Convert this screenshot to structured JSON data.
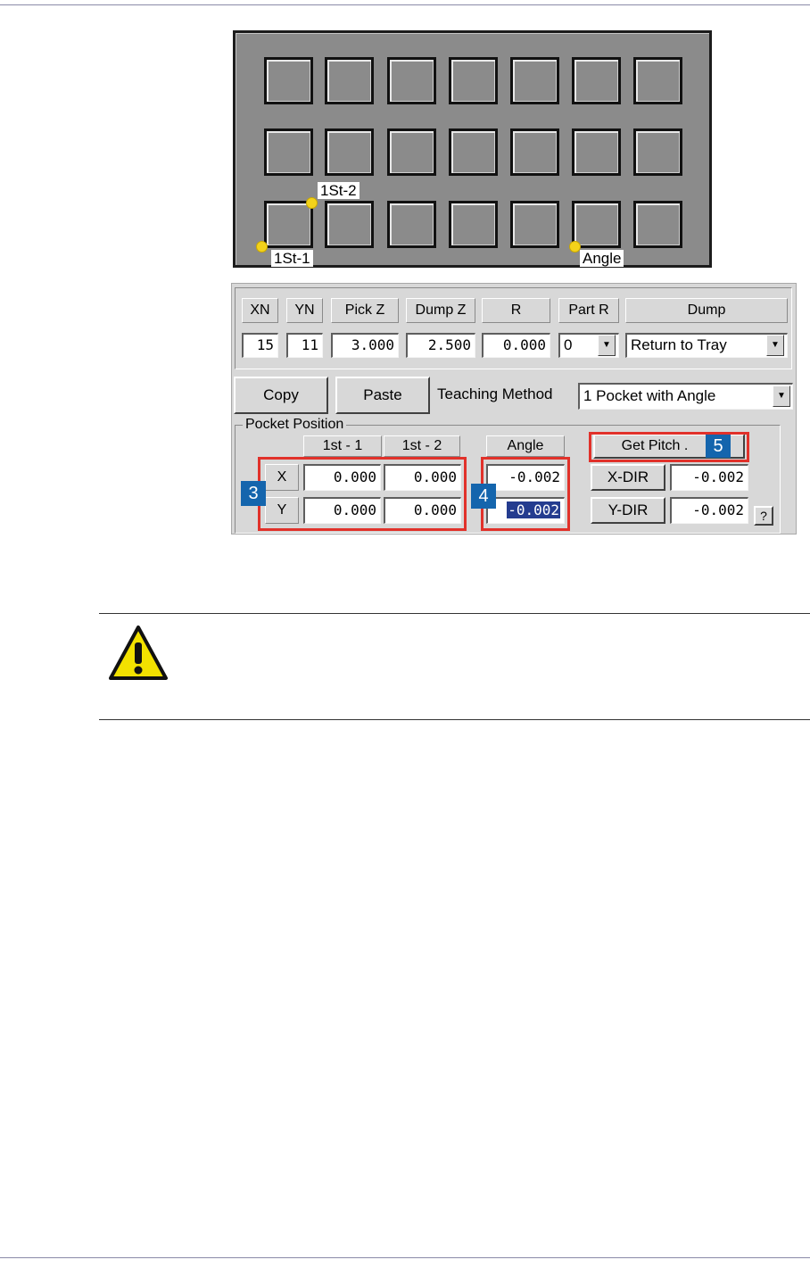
{
  "tray": {
    "labels": {
      "first1": "1St-1",
      "first2": "1St-2",
      "angle": "Angle"
    }
  },
  "params": {
    "headers": [
      "XN",
      "YN",
      "Pick Z",
      "Dump Z",
      "R",
      "Part R",
      "Dump"
    ],
    "xn": "15",
    "yn": "11",
    "pick_z": "3.000",
    "dump_z": "2.500",
    "r": "0.000",
    "part_r": "0",
    "dump": "Return to Tray"
  },
  "toolbar": {
    "copy_label": "Copy",
    "paste_label": "Paste",
    "teaching_method_label": "Teaching Method",
    "teaching_method_value": "1 Pocket with Angle"
  },
  "pocket_position": {
    "title": "Pocket Position",
    "col_1st1": "1st - 1",
    "col_1st2": "1st  - 2",
    "angle_header": "Angle",
    "x_label": "X",
    "y_label": "Y",
    "x_1st1": "0.000",
    "x_1st2": "0.000",
    "y_1st1": "0.000",
    "y_1st2": "0.000",
    "angle_x": "-0.002",
    "angle_y": "-0.002",
    "get_pitch_label": "Get Pitch .",
    "xdir_label": "X-DIR",
    "xdir_value": "-0.002",
    "ydir_label": "Y-DIR",
    "ydir_value": "-0.002",
    "help_label": "?"
  },
  "callouts": {
    "badge3": "3",
    "badge4": "4",
    "badge5": "5"
  },
  "colors": {
    "callout": "#e1312a",
    "badge": "#1465ad",
    "warning": "#f2e100"
  },
  "icons": {
    "caution": "warning-triangle-icon",
    "dropdown": "chevron-down-icon"
  }
}
